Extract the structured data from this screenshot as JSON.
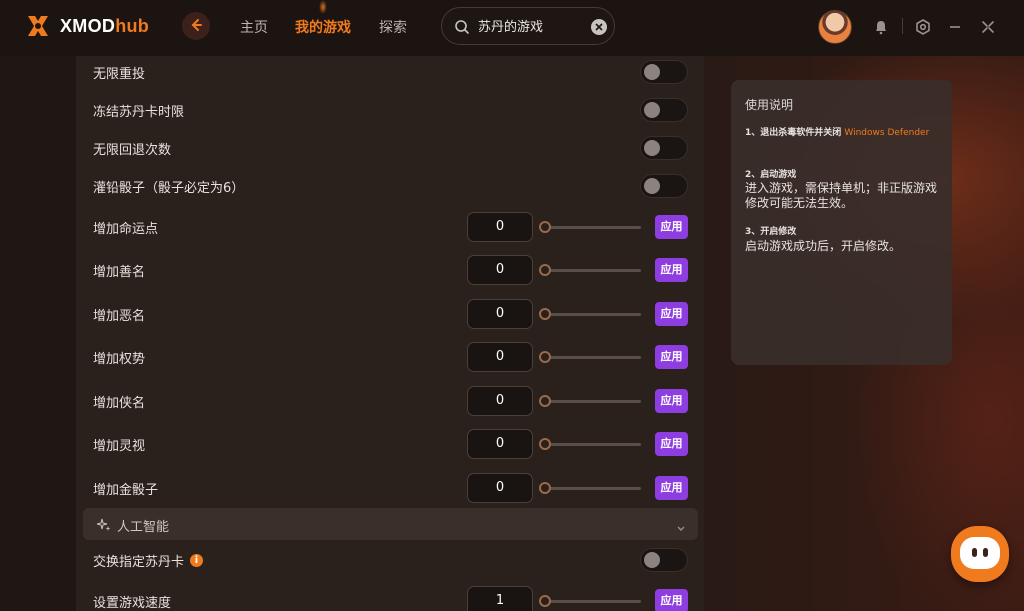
{
  "app": {
    "brand_main": "XMOD",
    "brand_accent": "hub"
  },
  "nav": {
    "items": [
      {
        "label": "主页"
      },
      {
        "label": "我的游戏"
      },
      {
        "label": "探索"
      }
    ],
    "active_index": 1
  },
  "search": {
    "value": "苏丹的游戏",
    "placeholder": ""
  },
  "colors": {
    "accent": "#f07a1e",
    "apply": "#8e3ee0",
    "panel": "#2a201c"
  },
  "toggles": [
    {
      "label": "无限重投",
      "on": false
    },
    {
      "label": "冻结苏丹卡时限",
      "on": false
    },
    {
      "label": "无限回退次数",
      "on": false
    },
    {
      "label": "灌铅骰子（骰子必定为6）",
      "on": false
    }
  ],
  "sliders": [
    {
      "label": "增加命运点",
      "value": "0",
      "apply_label": "应用"
    },
    {
      "label": "增加善名",
      "value": "0",
      "apply_label": "应用"
    },
    {
      "label": "增加恶名",
      "value": "0",
      "apply_label": "应用"
    },
    {
      "label": "增加权势",
      "value": "0",
      "apply_label": "应用"
    },
    {
      "label": "增加侠名",
      "value": "0",
      "apply_label": "应用"
    },
    {
      "label": "增加灵视",
      "value": "0",
      "apply_label": "应用"
    },
    {
      "label": "增加金骰子",
      "value": "0",
      "apply_label": "应用"
    }
  ],
  "ai_section": {
    "title": "人工智能",
    "toggle": {
      "label": "交换指定苏丹卡",
      "on": false
    },
    "speed": {
      "label": "设置游戏速度",
      "value": "1",
      "apply_label": "应用"
    }
  },
  "instructions": {
    "title": "使用说明",
    "step1_head": "1、退出杀毒软件并关闭",
    "step1_accent": "Windows Defender",
    "step2_head": "2、启动游戏",
    "step2_body": "进入游戏，需保持单机；非正版游戏修改可能无法生效。",
    "step3_head": "3、开启修改",
    "step3_body": "启动游戏成功后，开启修改。"
  },
  "icons": {
    "logo": "xmod-logo-icon",
    "back": "back-arrow-icon",
    "search": "search-icon",
    "clear": "clear-icon",
    "notify": "notification-icon",
    "settings": "settings-icon",
    "minimize": "minimize-icon",
    "close": "close-icon",
    "chat": "chat-assistant-icon"
  }
}
